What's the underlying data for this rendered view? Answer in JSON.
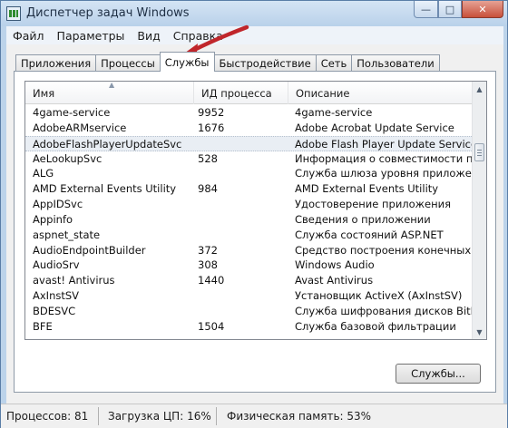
{
  "window": {
    "title": "Диспетчер задач Windows",
    "caption_minimize": "—",
    "caption_maximize": "□",
    "caption_close": "✕"
  },
  "menu": [
    "Файл",
    "Параметры",
    "Вид",
    "Справка"
  ],
  "tabs": [
    {
      "label": "Приложения",
      "active": false
    },
    {
      "label": "Процессы",
      "active": false
    },
    {
      "label": "Службы",
      "active": true
    },
    {
      "label": "Быстродействие",
      "active": false
    },
    {
      "label": "Сеть",
      "active": false
    },
    {
      "label": "Пользователи",
      "active": false
    }
  ],
  "services": {
    "columns": [
      "Имя",
      "ИД процесса",
      "Описание"
    ],
    "sort_indicator": "▲",
    "rows": [
      {
        "name": "4game-service",
        "pid": "9952",
        "description": "4game-service"
      },
      {
        "name": "AdobeARMservice",
        "pid": "1676",
        "description": "Adobe Acrobat Update Service"
      },
      {
        "name": "AdobeFlashPlayerUpdateSvc",
        "pid": "",
        "description": "Adobe Flash Player Update Service",
        "highlighted": true
      },
      {
        "name": "AeLookupSvc",
        "pid": "528",
        "description": "Информация о совместимости прил"
      },
      {
        "name": "ALG",
        "pid": "",
        "description": "Служба шлюза уровня приложения"
      },
      {
        "name": "AMD External Events Utility",
        "pid": "984",
        "description": "AMD External Events Utility"
      },
      {
        "name": "AppIDSvc",
        "pid": "",
        "description": "Удостоверение приложения"
      },
      {
        "name": "Appinfo",
        "pid": "",
        "description": "Сведения о приложении"
      },
      {
        "name": "aspnet_state",
        "pid": "",
        "description": "Служба состояний ASP.NET"
      },
      {
        "name": "AudioEndpointBuilder",
        "pid": "372",
        "description": "Средство построения конечных точ"
      },
      {
        "name": "AudioSrv",
        "pid": "308",
        "description": "Windows Audio"
      },
      {
        "name": "avast! Antivirus",
        "pid": "1440",
        "description": "Avast Antivirus"
      },
      {
        "name": "AxInstSV",
        "pid": "",
        "description": "Установщик ActiveX (AxInstSV)"
      },
      {
        "name": "BDESVC",
        "pid": "",
        "description": "Служба шифрования дисков BitLocke"
      },
      {
        "name": "BFE",
        "pid": "1504",
        "description": "Служба базовой фильтрации"
      }
    ],
    "scroll_up": "▲",
    "scroll_down": "▼"
  },
  "services_button": "Службы...",
  "status": {
    "processes": "Процессов: 81",
    "cpu": "Загрузка ЦП: 16%",
    "memory": "Физическая память: 53%"
  },
  "colors": {
    "annotation_arrow": "#c0262b",
    "window_frame": "#bcd3ea"
  }
}
